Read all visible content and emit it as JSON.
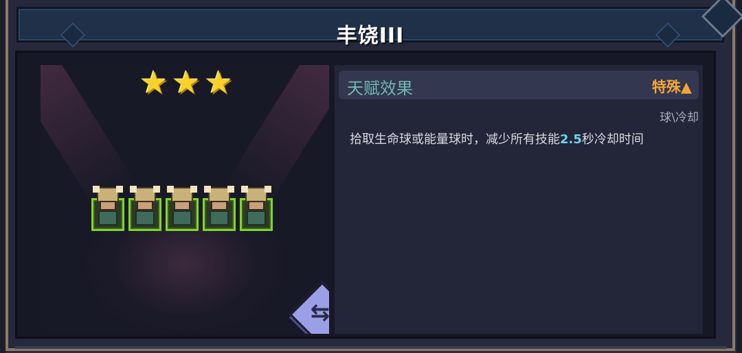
{
  "window": {
    "title": "丰饶III"
  },
  "rating": {
    "stars": 3,
    "star_glyph": "★"
  },
  "lineup": {
    "unit_count": 5,
    "border_color": "#7fd62a"
  },
  "swap_button": {
    "icon": "swap-arrows-icon",
    "glyph": "⇆"
  },
  "talent": {
    "header_title": "天赋效果",
    "type_label": "特殊▲",
    "tag": "球\\冷却",
    "desc_before": "拾取生命球或能量球时，减少所有技能",
    "desc_value": "2.5",
    "desc_after": "秒冷却时间",
    "colors": {
      "title": "#6fb7b3",
      "type": "#f3a53a",
      "value": "#6fd6e8"
    }
  }
}
